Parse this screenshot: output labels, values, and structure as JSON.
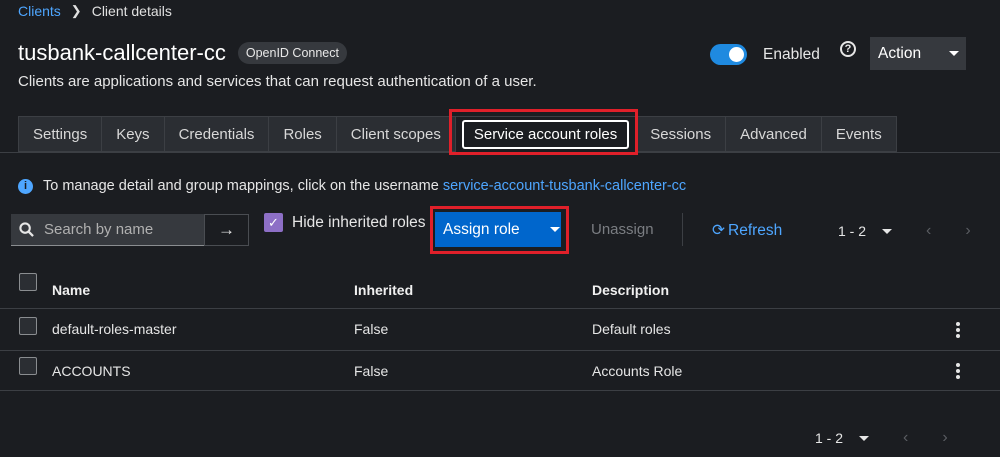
{
  "breadcrumb": {
    "parent": "Clients",
    "current": "Client details"
  },
  "header": {
    "title": "tusbank-callcenter-cc",
    "protocol_badge": "OpenID Connect",
    "subtitle": "Clients are applications and services that can request authentication of a user.",
    "enabled_label": "Enabled",
    "enabled": true,
    "help_icon": "?",
    "action_label": "Action"
  },
  "tabs": [
    {
      "label": "Settings"
    },
    {
      "label": "Keys"
    },
    {
      "label": "Credentials"
    },
    {
      "label": "Roles"
    },
    {
      "label": "Client scopes"
    },
    {
      "label": "Service account roles",
      "active": true
    },
    {
      "label": "Sessions"
    },
    {
      "label": "Advanced"
    },
    {
      "label": "Events"
    }
  ],
  "info": {
    "icon": "i",
    "text": "To manage detail and group mappings, click on the username",
    "link": "service-account-tusbank-callcenter-cc"
  },
  "toolbar": {
    "search_placeholder": "Search by name",
    "search_go_icon": "→",
    "hide_inherited_label": "Hide inherited roles",
    "hide_inherited_checked": true,
    "checkbox_mark": "✓",
    "assign_label": "Assign role",
    "unassign_label": "Unassign",
    "refresh_icon": "⟳",
    "refresh_label": "Refresh",
    "pagination": "1 - 2",
    "prev_icon": "‹",
    "next_icon": "›"
  },
  "table": {
    "columns": [
      "Name",
      "Inherited",
      "Description"
    ],
    "rows": [
      {
        "name": "default-roles-master",
        "inherited": "False",
        "description": "Default roles"
      },
      {
        "name": "ACCOUNTS",
        "inherited": "False",
        "description": "Accounts Role"
      }
    ]
  },
  "footer": {
    "pagination": "1 - 2"
  },
  "colors": {
    "accent": "#0066cc",
    "link": "#4ea6ff",
    "highlight": "#e0202a",
    "background": "#1b1d21"
  }
}
